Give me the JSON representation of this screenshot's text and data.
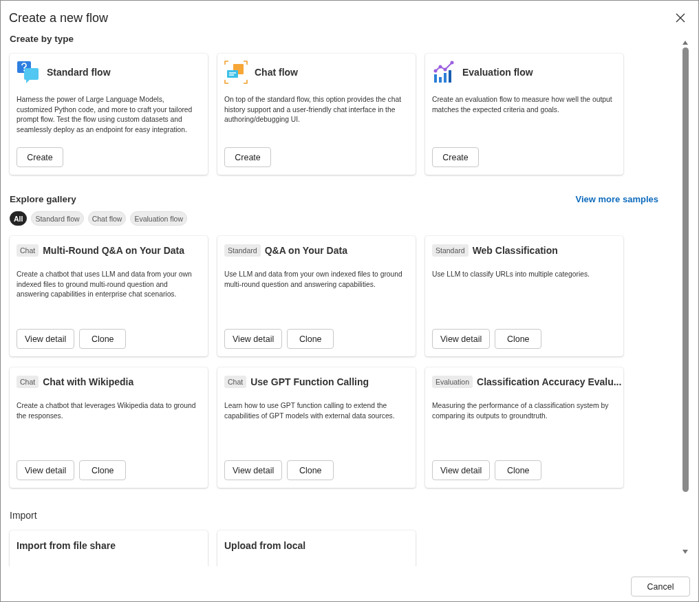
{
  "dialog": {
    "title": "Create a new flow"
  },
  "create_by_type": {
    "heading": "Create by type",
    "cards": [
      {
        "kind": "standard",
        "title": "Standard flow",
        "description": "Harness the power of Large Language Models, customized Python code, and more to craft your tailored prompt flow. Test the flow using custom datasets and seamlessly deploy as an endpoint for easy integration.",
        "button": "Create"
      },
      {
        "kind": "chat",
        "title": "Chat flow",
        "description": "On top of the standard flow, this option provides the chat history support and a user-friendly chat interface in the authoring/debugging UI.",
        "button": "Create"
      },
      {
        "kind": "evaluation",
        "title": "Evaluation flow",
        "description": "Create an evaluation flow to measure how well the output matches the expected criteria and goals.",
        "button": "Create"
      }
    ]
  },
  "explore_gallery": {
    "heading": "Explore gallery",
    "view_more_link": "View more samples",
    "filters": [
      {
        "label": "All",
        "selected": true
      },
      {
        "label": "Standard flow",
        "selected": false
      },
      {
        "label": "Chat flow",
        "selected": false
      },
      {
        "label": "Evaluation flow",
        "selected": false
      }
    ],
    "samples": [
      {
        "tag": "Chat",
        "title": "Multi-Round Q&A on Your Data",
        "description": "Create a chatbot that uses LLM and data from your own indexed files to ground multi-round question and answering capabilities in enterprise chat scenarios.",
        "buttons": [
          "View detail",
          "Clone"
        ]
      },
      {
        "tag": "Standard",
        "title": "Q&A on Your Data",
        "description": "Use LLM and data from your own indexed files to ground multi-round question and answering capabilities.",
        "buttons": [
          "View detail",
          "Clone"
        ]
      },
      {
        "tag": "Standard",
        "title": "Web Classification",
        "description": "Use LLM to classify URLs into multiple categories.",
        "buttons": [
          "View detail",
          "Clone"
        ]
      },
      {
        "tag": "Chat",
        "title": "Chat with Wikipedia",
        "description": "Create a chatbot that leverages Wikipedia data to ground the responses.",
        "buttons": [
          "View detail",
          "Clone"
        ]
      },
      {
        "tag": "Chat",
        "title": "Use GPT Function Calling",
        "description": "Learn how to use GPT function calling to extend the capabilities of GPT models with external data sources.",
        "buttons": [
          "View detail",
          "Clone"
        ]
      },
      {
        "tag": "Evaluation",
        "title": "Classification Accuracy Evalu...",
        "description": "Measuring the performance of a classification system by comparing its outputs to groundtruth.",
        "buttons": [
          "View detail",
          "Clone"
        ]
      }
    ]
  },
  "import": {
    "heading": "Import",
    "cards": [
      {
        "title": "Import from file share"
      },
      {
        "title": "Upload from local"
      }
    ]
  },
  "footer": {
    "buttons": [
      "Cancel"
    ]
  }
}
